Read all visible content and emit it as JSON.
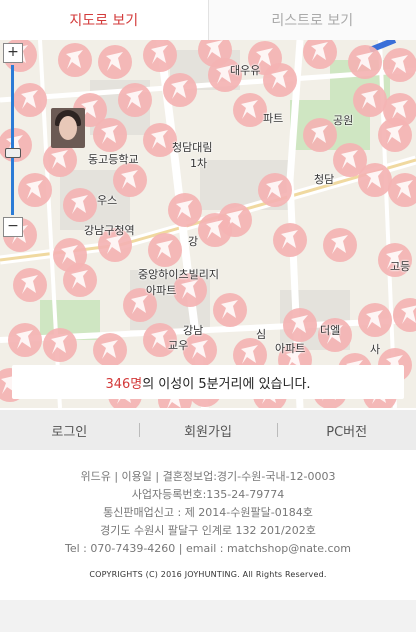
{
  "tabs": {
    "map_label": "지도로 보기",
    "list_label": "리스트로 보기"
  },
  "map": {
    "labels": [
      "동고등학교",
      "청담대림",
      "1차",
      "강남구청역",
      "중앙하이츠빌리지",
      "아파트",
      "강남",
      "교우",
      "우스",
      "강",
      "대우유",
      "파트",
      "공원",
      "청담",
      "더엘",
      "사",
      "심",
      "아파트",
      "고등"
    ],
    "zoom": {
      "in": "+",
      "out": "−",
      "level_fraction": 0.42
    }
  },
  "banner": {
    "count": "346명",
    "text": "의 이성이 5분거리에 있습니다."
  },
  "nav": {
    "login": "로그인",
    "signup": "회원가입",
    "pc": "PC버전"
  },
  "footer": {
    "line1": "위드유 | 이용일 | 결혼정보업:경기-수원-국내-12-0003",
    "line2": "사업자등록번호:135-24-79774",
    "line3": "통신판매업신고 : 제 2014-수원팔달-0184호",
    "line4": "경기도 수원시 팔달구 인계로 132 201/202호",
    "line5": "Tel : 070-7439-4260 | email : matchshop@nate.com",
    "copyright": "COPYRIGHTS (C) 2016 JOYHUNTING. All Rights Reserved."
  },
  "colors": {
    "accent": "#d33a3a",
    "marker": "#f4b3b3",
    "road": "#ffffff",
    "park": "#cfe6c2",
    "block": "#e4e2dc"
  }
}
